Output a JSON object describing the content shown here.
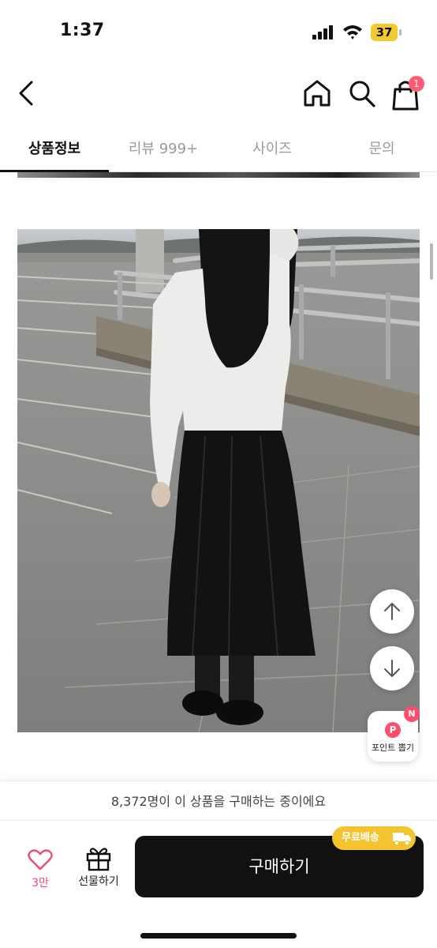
{
  "status_bar": {
    "time": "1:37",
    "battery_level": "37"
  },
  "header": {
    "back_icon": "chevron-left-icon",
    "home_icon": "home-icon",
    "search_icon": "search-icon",
    "cart_icon": "shopping-bag-icon",
    "cart_count": "1"
  },
  "tabs": [
    {
      "label": "상품정보",
      "active": true
    },
    {
      "label": "리뷰 999+",
      "active": false
    },
    {
      "label": "사이즈",
      "active": false
    },
    {
      "label": "문의",
      "active": false
    }
  ],
  "floating": {
    "scroll_up_icon": "arrow-up-icon",
    "scroll_down_icon": "arrow-down-icon",
    "point_letter": "P",
    "point_label": "포인트 뽑기",
    "point_badge": "N"
  },
  "bottom": {
    "buyer_count_text": "8,372명이 이 상품을 구매하는 중이에요",
    "like_icon": "heart-icon",
    "like_count": "3만",
    "gift_icon": "gift-icon",
    "gift_label": "선물하기",
    "buy_label": "구매하기",
    "shipping_badge": "무료배송",
    "shipping_icon": "truck-icon"
  },
  "colors": {
    "accent_pink": "#f04a6a",
    "badge_pink": "#ff5a72",
    "shipping_yellow": "#f4c430",
    "buy_button": "#111111"
  }
}
